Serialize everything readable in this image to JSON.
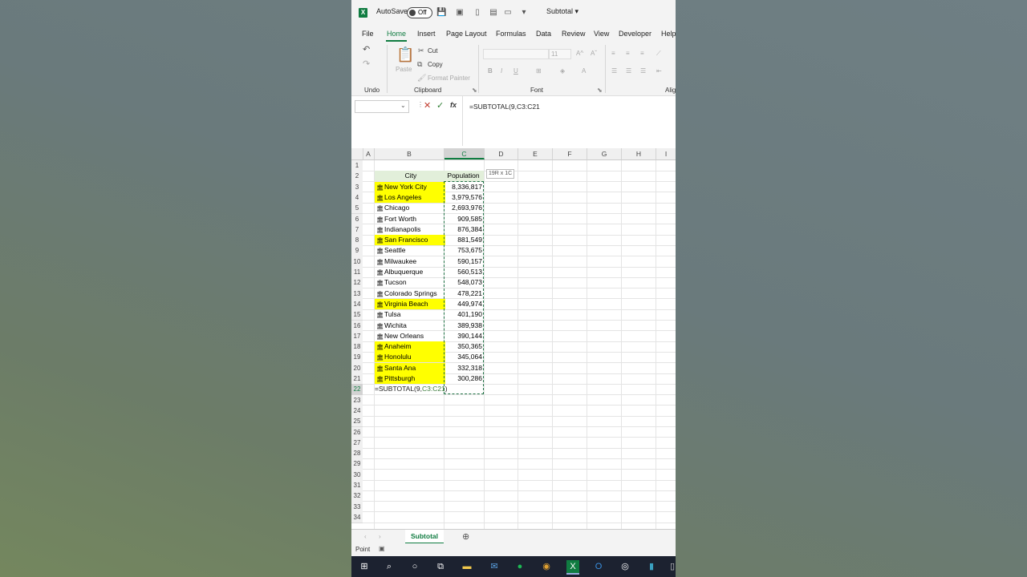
{
  "titlebar": {
    "autosave_label": "AutoSave",
    "autosave_state": "Off",
    "doc_name": "Subtotal ▾"
  },
  "tabs": [
    "File",
    "Home",
    "Insert",
    "Page Layout",
    "Formulas",
    "Data",
    "Review",
    "View",
    "Developer",
    "Help"
  ],
  "ribbon": {
    "undo_group": "Undo",
    "clipboard": {
      "paste": "Paste",
      "cut": "Cut",
      "copy": "Copy",
      "format_painter": "Format Painter",
      "label": "Clipboard"
    },
    "font": {
      "size": "11",
      "label": "Font"
    },
    "align_label": "Alig"
  },
  "formula_bar": {
    "formula": "=SUBTOTAL(9,C3:C21"
  },
  "columns": [
    "A",
    "B",
    "C",
    "D",
    "E",
    "F",
    "G",
    "H",
    "I"
  ],
  "rows": [
    "1",
    "2",
    "3",
    "4",
    "5",
    "6",
    "7",
    "8",
    "9",
    "10",
    "11",
    "12",
    "13",
    "14",
    "15",
    "16",
    "17",
    "18",
    "19",
    "20",
    "21",
    "22",
    "23",
    "24",
    "25",
    "26",
    "27",
    "28",
    "29",
    "30",
    "31",
    "32",
    "33",
    "34"
  ],
  "table": {
    "header_city": "City",
    "header_population": "Population",
    "rows": [
      {
        "city": "New York City",
        "population": "8,336,817",
        "highlight": true
      },
      {
        "city": "Los Angeles",
        "population": "3,979,576",
        "highlight": true
      },
      {
        "city": "Chicago",
        "population": "2,693,976",
        "highlight": false
      },
      {
        "city": "Fort Worth",
        "population": "909,585",
        "highlight": false
      },
      {
        "city": "Indianapolis",
        "population": "876,384",
        "highlight": false
      },
      {
        "city": "San Francisco",
        "population": "881,549",
        "highlight": true
      },
      {
        "city": "Seattle",
        "population": "753,675",
        "highlight": false
      },
      {
        "city": "Milwaukee",
        "population": "590,157",
        "highlight": false
      },
      {
        "city": "Albuquerque",
        "population": "560,513",
        "highlight": false
      },
      {
        "city": "Tucson",
        "population": "548,073",
        "highlight": false
      },
      {
        "city": "Colorado Springs",
        "population": "478,221",
        "highlight": false
      },
      {
        "city": "Virginia Beach",
        "population": "449,974",
        "highlight": true
      },
      {
        "city": "Tulsa",
        "population": "401,190",
        "highlight": false
      },
      {
        "city": "Wichita",
        "population": "389,938",
        "highlight": false
      },
      {
        "city": "New Orleans",
        "population": "390,144",
        "highlight": false
      },
      {
        "city": "Anaheim",
        "population": "350,365",
        "highlight": true
      },
      {
        "city": "Honolulu",
        "population": "345,064",
        "highlight": true
      },
      {
        "city": "Santa Ana",
        "population": "332,318",
        "highlight": true
      },
      {
        "city": "Pittsburgh",
        "population": "300,286",
        "highlight": true
      }
    ]
  },
  "edit_cell": {
    "prefix": "=SUBTOTAL(9,",
    "ref": "C3:C21",
    "suffix": ")"
  },
  "size_tooltip": "19R x 1C",
  "sheet_tab": "Subtotal",
  "status": "Point",
  "colors": {
    "excel_green": "#107c41",
    "highlight": "#ffff00",
    "header_fill": "#e2efda"
  }
}
